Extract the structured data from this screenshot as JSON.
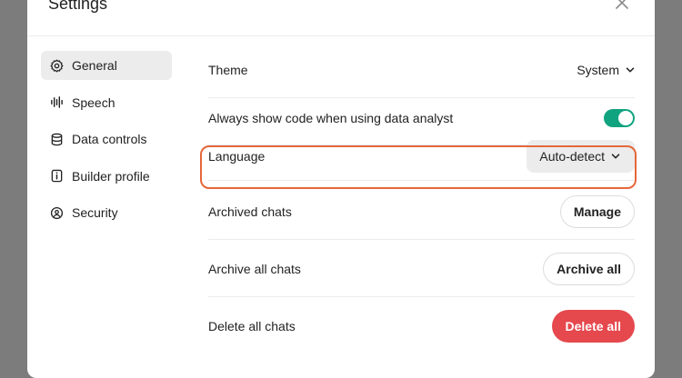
{
  "dialog": {
    "title": "Settings",
    "close_icon": "close-icon"
  },
  "sidebar": {
    "items": [
      {
        "label": "General",
        "icon": "gear-icon",
        "active": true
      },
      {
        "label": "Speech",
        "icon": "waveform-icon",
        "active": false
      },
      {
        "label": "Data controls",
        "icon": "database-icon",
        "active": false
      },
      {
        "label": "Builder profile",
        "icon": "id-card-icon",
        "active": false
      },
      {
        "label": "Security",
        "icon": "shield-icon",
        "active": false
      }
    ]
  },
  "settings": {
    "theme": {
      "label": "Theme",
      "value": "System"
    },
    "code": {
      "label": "Always show code when using data analyst",
      "enabled": true
    },
    "language": {
      "label": "Language",
      "value": "Auto-detect"
    },
    "archived": {
      "label": "Archived chats",
      "button": "Manage"
    },
    "archive_all": {
      "label": "Archive all chats",
      "button": "Archive all"
    },
    "delete_all": {
      "label": "Delete all chats",
      "button": "Delete all"
    }
  },
  "colors": {
    "toggle_on": "#10a37f",
    "highlight": "#e5673a",
    "danger": "#e5484d"
  }
}
